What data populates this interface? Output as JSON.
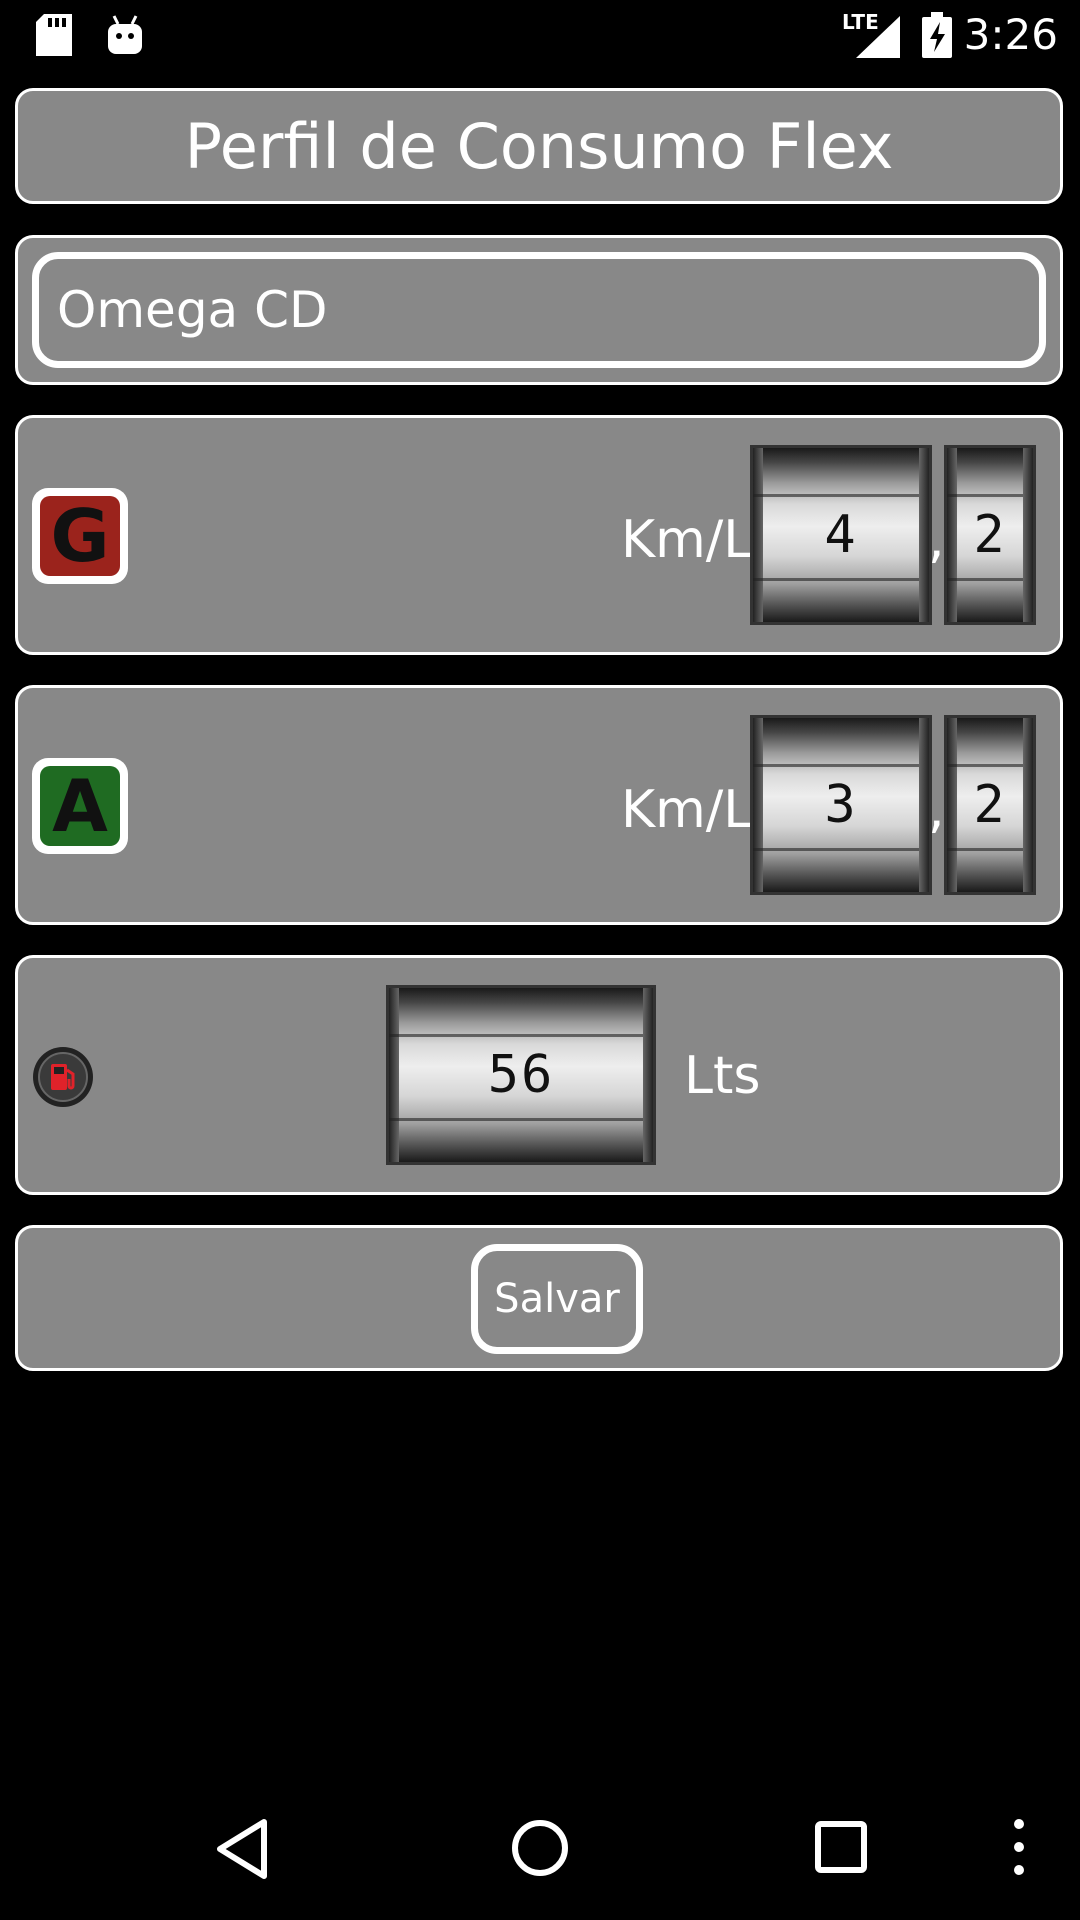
{
  "status_bar": {
    "time": "3:26",
    "network": "LTE"
  },
  "header": {
    "title": "Perfil de Consumo Flex"
  },
  "vehicle": {
    "name": "Omega CD"
  },
  "gasoline": {
    "badge": "G",
    "badge_color": "#9b231c",
    "unit": "Km/L",
    "integer": "4",
    "separator": ",",
    "decimal": "2"
  },
  "alcohol": {
    "badge": "A",
    "badge_color": "#1f6b22",
    "unit": "Km/L",
    "integer": "3",
    "separator": ",",
    "decimal": "2"
  },
  "tank": {
    "value": "56",
    "unit": "Lts"
  },
  "actions": {
    "save_label": "Salvar"
  },
  "icons": {
    "sd_card": "sd-card-icon",
    "android": "android-debug-icon",
    "signal": "signal-icon",
    "battery": "battery-charging-icon",
    "fuel": "fuel-pump-icon",
    "back": "back-icon",
    "home": "home-icon",
    "recents": "recents-icon",
    "overflow": "overflow-menu-icon"
  }
}
